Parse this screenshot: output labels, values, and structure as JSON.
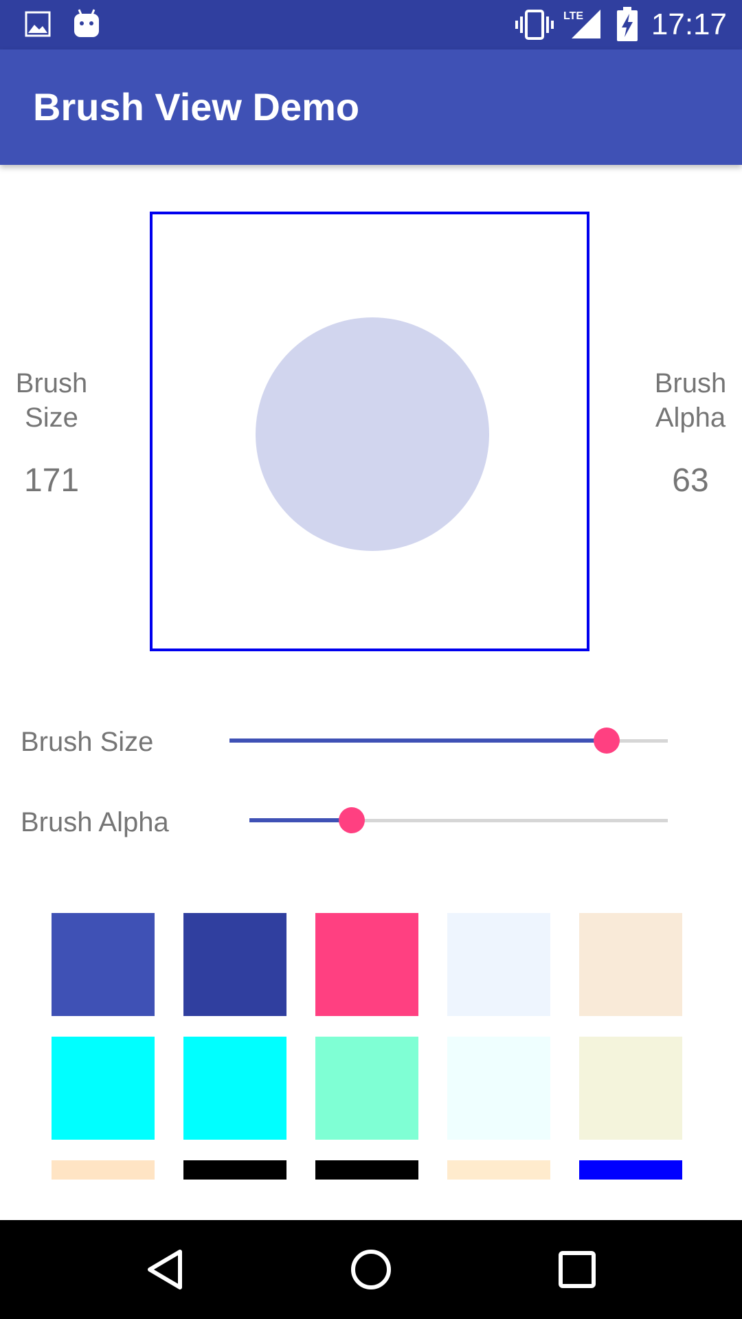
{
  "status_bar": {
    "time": "17:17",
    "icons": [
      "image-icon",
      "android-icon",
      "vibrate-icon",
      "lte-signal-icon",
      "battery-charging-icon"
    ]
  },
  "app_bar": {
    "title": "Brush View Demo"
  },
  "brush_preview": {
    "circle_color": "#d1d5ee",
    "border_color": "#0000ee"
  },
  "brush_size_panel": {
    "label_line1": "Brush",
    "label_line2": "Size",
    "value": "171"
  },
  "brush_alpha_panel": {
    "label_line1": "Brush",
    "label_line2": "Alpha",
    "value": "63"
  },
  "sliders": {
    "size": {
      "label": "Brush Size",
      "fraction": 0.86
    },
    "alpha": {
      "label": "Brush Alpha",
      "fraction": 0.245
    }
  },
  "colors": {
    "accent": "#ff4081",
    "primary": "#3f51b5",
    "primary_dark": "#303f9f"
  },
  "palette": [
    [
      "#3f51b5",
      "#303f9f",
      "#ff4081",
      "#eef5fe",
      "#f9ead8"
    ],
    [
      "#00ffff",
      "#00ffff",
      "#7fffd4",
      "#efffff",
      "#f4f4dc"
    ],
    [
      "#ffe4c4",
      "#000000",
      "#000000",
      "#ffebcd",
      "#0000ff"
    ]
  ],
  "nav_bar": {
    "icons": [
      "back-icon",
      "home-icon",
      "recents-icon"
    ]
  }
}
